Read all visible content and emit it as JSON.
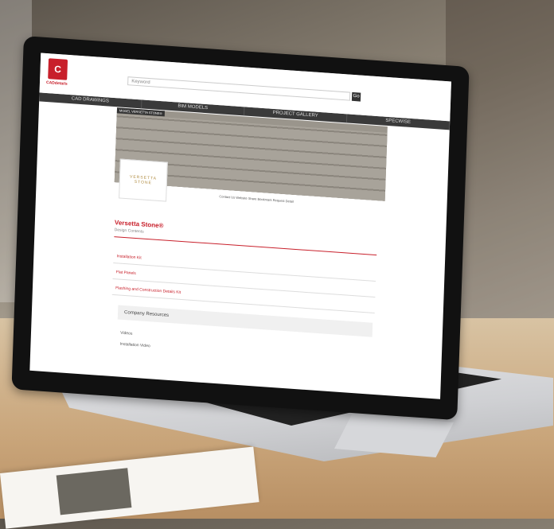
{
  "header": {
    "logo_mark": "C",
    "logo_text": "CADdetails",
    "search_placeholder": "Keyword",
    "search_button": "Go"
  },
  "nav": [
    "CAD DRAWINGS",
    "BIM MODELS",
    "PROJECT GALLERY",
    "SPECWISE"
  ],
  "banner": {
    "label": "MODEL VERSETTA STONE®",
    "brand": "VERSETTA STONE",
    "tools": "Contact Us   Website   Share   Bookmark   Request Detail"
  },
  "company": {
    "name": "Versetta Stone®",
    "subtitle": "Design Contents"
  },
  "rows": [
    "Installation Kit",
    "Flat Panels",
    "Flashing and Construction Details Kit"
  ],
  "resources": {
    "title": "Company Resources",
    "links": [
      "Videos",
      "Installation Video"
    ]
  }
}
